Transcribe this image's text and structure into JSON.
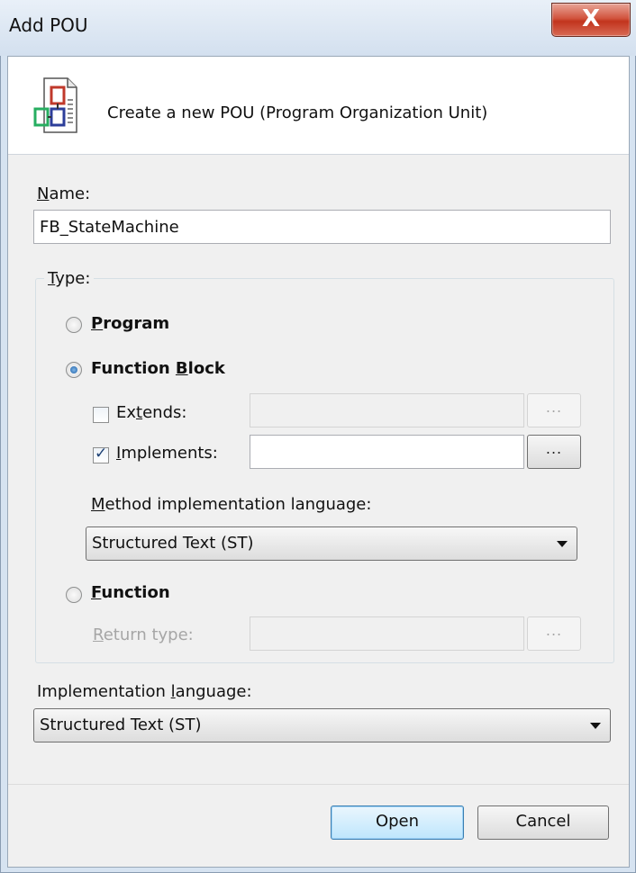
{
  "window": {
    "title": "Add POU",
    "close_glyph": "X"
  },
  "header": {
    "text": "Create a new POU (Program Organization Unit)",
    "icon": "pou-document-icon"
  },
  "name": {
    "label_first": "N",
    "label_rest": "ame:",
    "value": "FB_StateMachine"
  },
  "type": {
    "legend_first": "T",
    "legend_rest": "ype:",
    "program": {
      "first": "P",
      "rest": "rogram",
      "checked": false
    },
    "function_block": {
      "before": "Function ",
      "first": "B",
      "rest": "lock",
      "checked": true
    },
    "extends": {
      "before": "Ex",
      "first": "t",
      "rest": "ends:",
      "checked": false,
      "value": "",
      "button": "..."
    },
    "implements": {
      "first": "I",
      "rest": "mplements:",
      "checked": true,
      "value": "",
      "button": "..."
    },
    "method_lang": {
      "first": "M",
      "rest": "ethod implementation language:",
      "value": "Structured Text (ST)"
    },
    "function": {
      "first": "F",
      "rest": "unction",
      "checked": false
    },
    "return_type": {
      "first": "R",
      "rest": "eturn type:",
      "value": "",
      "button": "..."
    }
  },
  "impl_lang": {
    "before": "Implementation ",
    "first": "l",
    "rest": "anguage:",
    "value": "Structured Text (ST)"
  },
  "buttons": {
    "open": "Open",
    "cancel": "Cancel"
  }
}
